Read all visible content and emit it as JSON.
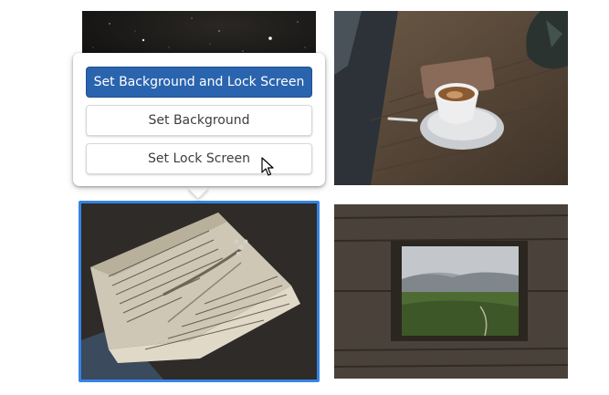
{
  "popover": {
    "set_both_label": "Set Background and Lock Screen",
    "set_background_label": "Set Background",
    "set_lock_screen_label": "Set Lock Screen"
  },
  "wallpapers": [
    {
      "name": "stars"
    },
    {
      "name": "coffee"
    },
    {
      "name": "journal"
    },
    {
      "name": "cabin-window"
    }
  ],
  "selected_wallpaper": "journal",
  "colors": {
    "accent": "#3584e4",
    "suggested_button": "#2a64ae"
  },
  "icons": {
    "cursor": "arrow-cursor-icon"
  }
}
